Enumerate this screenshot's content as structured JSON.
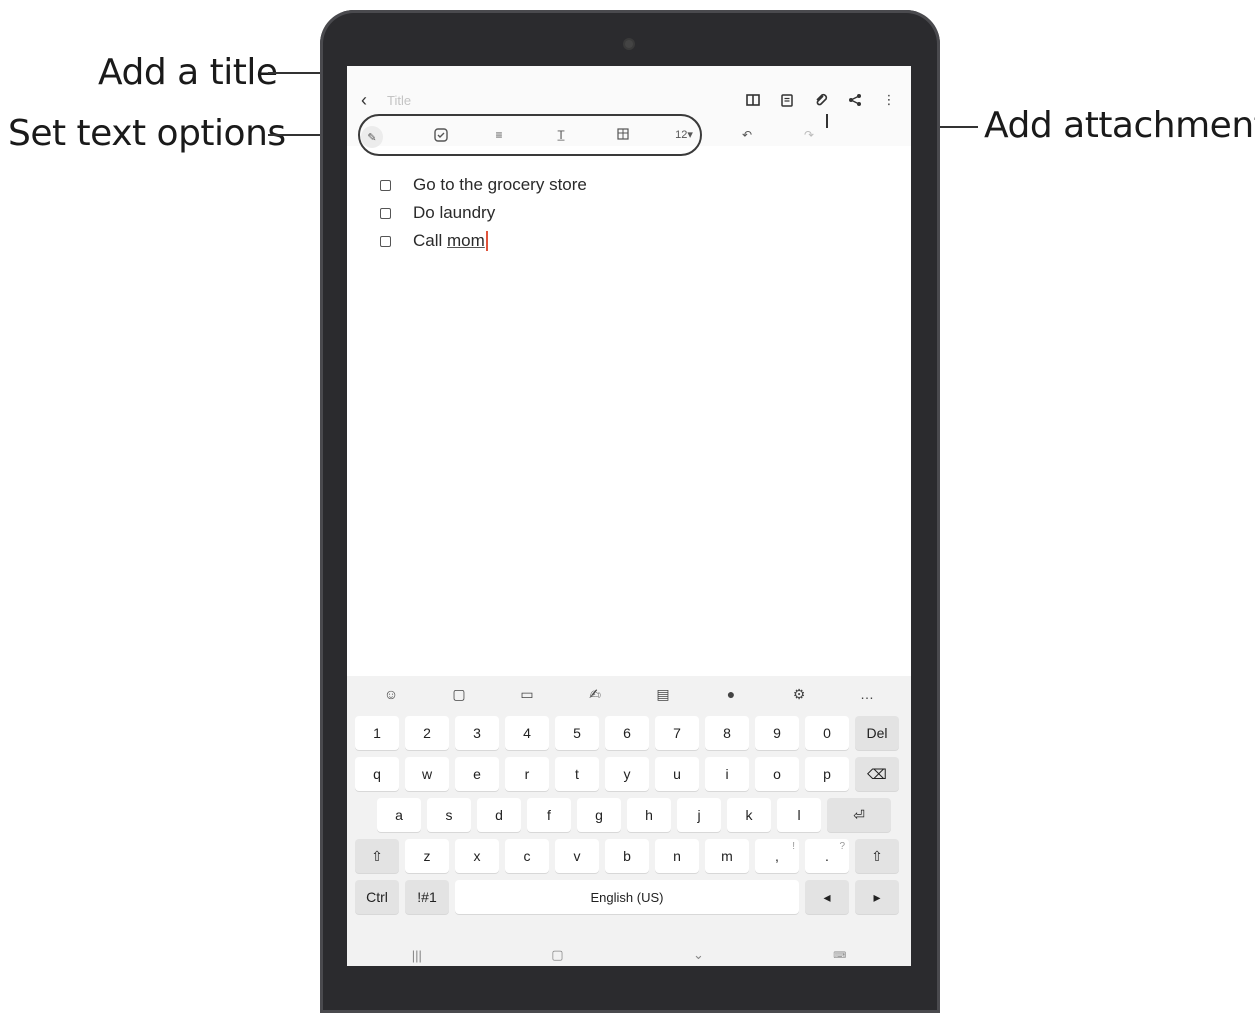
{
  "callouts": {
    "add_title": "Add a title",
    "set_text_options": "Set text options",
    "add_attachment": "Add attachment"
  },
  "topbar": {
    "back_icon": "chevron-left-icon",
    "title_placeholder": "Title",
    "icons": [
      "book-icon",
      "page-icon",
      "paperclip-icon",
      "share-icon",
      "more-vert-icon"
    ]
  },
  "toolbar": {
    "font_size": "12",
    "icons": [
      "pen-style-icon",
      "checkbox-icon",
      "text-style-icon",
      "text-format-icon",
      "table-icon",
      "font-size-dropdown",
      "undo-icon",
      "redo-icon"
    ]
  },
  "note": {
    "items": [
      "Go to the grocery store",
      "Do laundry"
    ],
    "last_item_prefix": "Call ",
    "last_item_word": "mom"
  },
  "keyboard": {
    "top_icons": [
      "emoji-icon",
      "sticker-icon",
      "gif-icon",
      "handwriting-icon",
      "clipboard-icon",
      "mic-icon",
      "settings-icon",
      "more-icon"
    ],
    "number_row": [
      "1",
      "2",
      "3",
      "4",
      "5",
      "6",
      "7",
      "8",
      "9",
      "0"
    ],
    "del_label": "Del",
    "row1": [
      "q",
      "w",
      "e",
      "r",
      "t",
      "y",
      "u",
      "i",
      "o",
      "p"
    ],
    "row2": [
      "a",
      "s",
      "d",
      "f",
      "g",
      "h",
      "j",
      "k",
      "l"
    ],
    "row3": [
      "z",
      "x",
      "c",
      "v",
      "b",
      "n",
      "m",
      ",",
      "."
    ],
    "row3_extra": [
      "!",
      "?"
    ],
    "ctrl_label": "Ctrl",
    "sym_label": "!#1",
    "space_label": "English (US)"
  }
}
